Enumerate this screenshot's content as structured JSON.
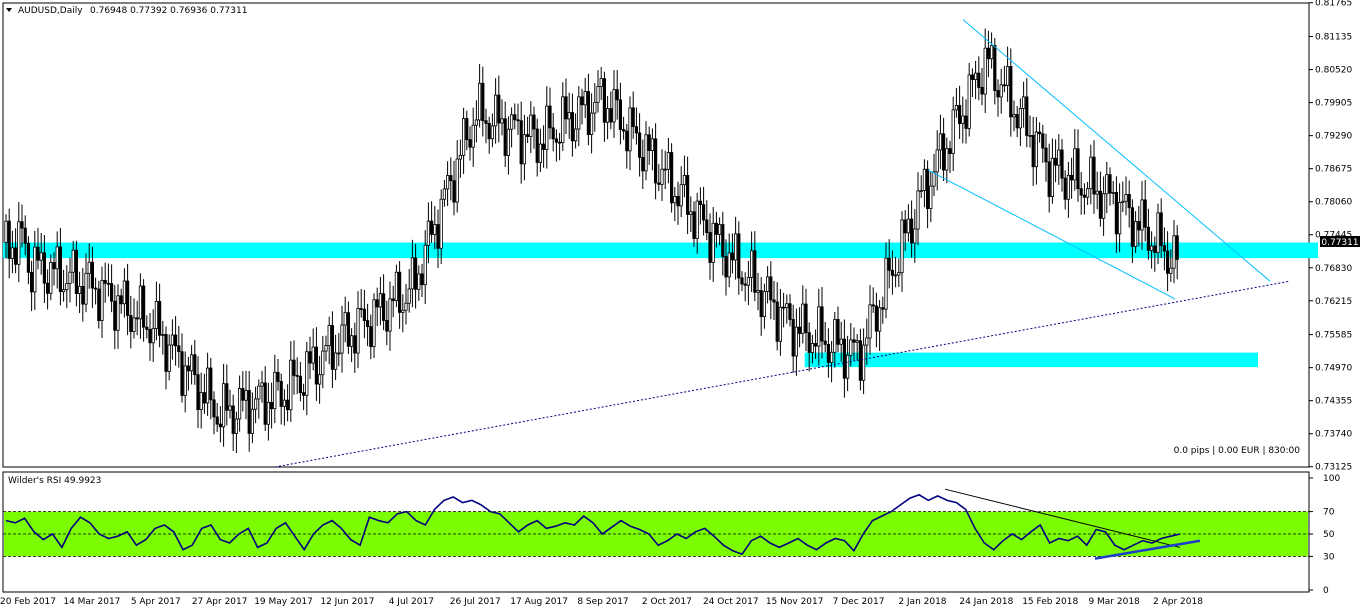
{
  "chart_data": [
    {
      "type": "candlestick",
      "header": {
        "symbol": "AUDUSD,Daily",
        "ohlc": "0.76948 0.77392 0.76936 0.77311"
      },
      "price_label": "0.77311",
      "status": "0.0 pips | 0.00 EUR | 830:00",
      "ylim": [
        0.7312,
        0.8176
      ],
      "y_ticks": [
        "0.81765",
        "0.81135",
        "0.80520",
        "0.79905",
        "0.79290",
        "0.78675",
        "0.78060",
        "0.77445",
        "0.76830",
        "0.76215",
        "0.75585",
        "0.74970",
        "0.74355",
        "0.73740",
        "0.73125"
      ],
      "date_labels": [
        "20 Feb 2017",
        "14 Mar 2017",
        "5 Apr 2017",
        "27 Apr 2017",
        "19 May 2017",
        "12 Jun 2017",
        "4 Jul 2017",
        "26 Jul 2017",
        "17 Aug 2017",
        "8 Sep 2017",
        "2 Oct 2017",
        "24 Oct 2017",
        "15 Nov 2017",
        "7 Dec 2017",
        "2 Jan 2018",
        "24 Jan 2018",
        "15 Feb 2018",
        "9 Mar 2018",
        "2 Apr 2018"
      ],
      "zones": [
        {
          "from": 0.7701,
          "to": 0.773,
          "color": "#00FFFF"
        },
        {
          "from": 0.7498,
          "to": 0.7525,
          "color": "#00FFFF",
          "x_start": "15 Nov 2017"
        }
      ],
      "bull_color": "#000000",
      "bear_color": "#000000",
      "close_path": [
        [
          "20 Feb 2017",
          0.769
        ],
        [
          "14 Mar 2017",
          0.765
        ],
        [
          "5 Apr 2017",
          0.757
        ],
        [
          "27 Apr 2017",
          0.741
        ],
        [
          "19 May 2017",
          0.745
        ],
        [
          "12 Jun 2017",
          0.756
        ],
        [
          "4 Jul 2017",
          0.764
        ],
        [
          "26 Jul 2017",
          0.797
        ],
        [
          "17 Aug 2017",
          0.792
        ],
        [
          "8 Sep 2017",
          0.8
        ],
        [
          "2 Oct 2017",
          0.785
        ],
        [
          "24 Oct 2017",
          0.77
        ],
        [
          "15 Nov 2017",
          0.757
        ],
        [
          "7 Dec 2017",
          0.752
        ],
        [
          "2 Jan 2018",
          0.782
        ],
        [
          "24 Jan 2018",
          0.807
        ],
        [
          "15 Feb 2018",
          0.787
        ],
        [
          "9 Mar 2018",
          0.781
        ],
        [
          "2 Apr 2018",
          0.769
        ],
        [
          "2 Apr 2018",
          0.773
        ]
      ]
    },
    {
      "type": "line",
      "title": "Wilder's RSI 49.9923",
      "ylim": [
        0,
        100
      ],
      "y_ticks": [
        "100",
        "70",
        "50",
        "30",
        "0"
      ],
      "band": {
        "from": 30,
        "to": 70,
        "color": "#7CFC00"
      },
      "series": [
        {
          "color": "#000080",
          "values": [
            62,
            60,
            64,
            52,
            45,
            50,
            38,
            55,
            65,
            60,
            50,
            46,
            48,
            52,
            40,
            45,
            55,
            58,
            52,
            36,
            40,
            55,
            58,
            45,
            42,
            50,
            55,
            38,
            42,
            55,
            60,
            48,
            36,
            50,
            58,
            62,
            55,
            45,
            40,
            65,
            62,
            60,
            68,
            70,
            62,
            58,
            72,
            80,
            83,
            78,
            80,
            76,
            70,
            68,
            60,
            52,
            58,
            62,
            55,
            57,
            60,
            58,
            66,
            60,
            50,
            56,
            62,
            57,
            54,
            50,
            40,
            44,
            50,
            46,
            52,
            55,
            48,
            40,
            35,
            32,
            44,
            48,
            42,
            38,
            42,
            46,
            40,
            36,
            42,
            46,
            44,
            35,
            50,
            62,
            66,
            70,
            76,
            82,
            85,
            80,
            84,
            80,
            78,
            72,
            55,
            42,
            36,
            44,
            50,
            45,
            52,
            58,
            42,
            46,
            44,
            48,
            40,
            54,
            52,
            40,
            36,
            40,
            44,
            42,
            46,
            48,
            50
          ]
        }
      ]
    }
  ]
}
